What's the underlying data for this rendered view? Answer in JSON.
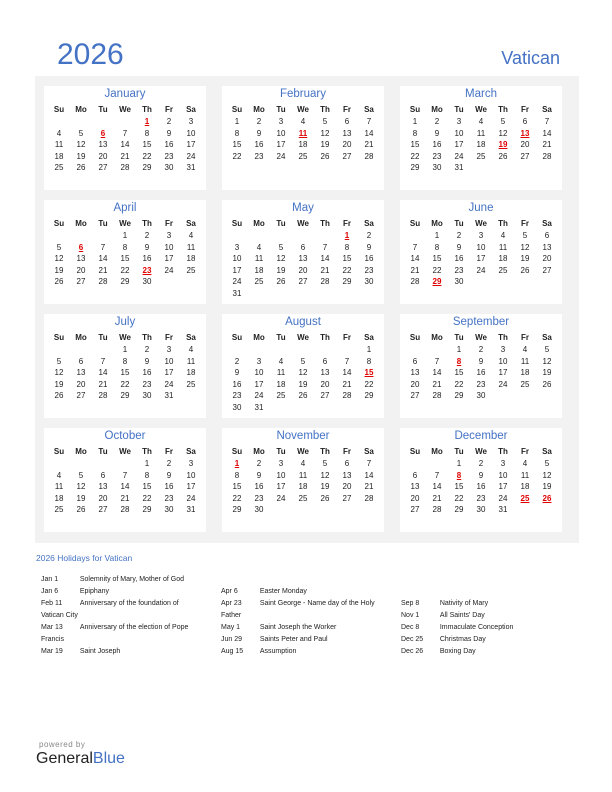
{
  "header": {
    "year": "2026",
    "country": "Vatican"
  },
  "weekdays": [
    "Su",
    "Mo",
    "Tu",
    "We",
    "Th",
    "Fr",
    "Sa"
  ],
  "months": [
    {
      "name": "January",
      "start": 4,
      "days": 31,
      "holidays": [
        1,
        6
      ]
    },
    {
      "name": "February",
      "start": 0,
      "days": 28,
      "holidays": [
        11
      ]
    },
    {
      "name": "March",
      "start": 0,
      "days": 31,
      "holidays": [
        13,
        19
      ]
    },
    {
      "name": "April",
      "start": 3,
      "days": 30,
      "holidays": [
        6,
        23
      ]
    },
    {
      "name": "May",
      "start": 5,
      "days": 31,
      "holidays": [
        1
      ]
    },
    {
      "name": "June",
      "start": 1,
      "days": 30,
      "holidays": [
        29
      ]
    },
    {
      "name": "July",
      "start": 3,
      "days": 31,
      "holidays": []
    },
    {
      "name": "August",
      "start": 6,
      "days": 31,
      "holidays": [
        15
      ]
    },
    {
      "name": "September",
      "start": 2,
      "days": 30,
      "holidays": [
        8
      ]
    },
    {
      "name": "October",
      "start": 4,
      "days": 31,
      "holidays": []
    },
    {
      "name": "November",
      "start": 0,
      "days": 30,
      "holidays": [
        1
      ]
    },
    {
      "name": "December",
      "start": 2,
      "days": 31,
      "holidays": [
        8,
        25,
        26
      ]
    }
  ],
  "holidays_title": "2026 Holidays for Vatican",
  "holidays_columns": [
    [
      {
        "date": "Jan 1",
        "name": "Solemnity of Mary, Mother of God"
      },
      {
        "date": "Jan 6",
        "name": "Epiphany"
      },
      {
        "date": "Feb 11",
        "name": "Anniversary of the foundation of Vatican City"
      },
      {
        "date": "Mar 13",
        "name": "Anniversary of the election of Pope Francis"
      },
      {
        "date": "Mar 19",
        "name": "Saint Joseph"
      }
    ],
    [
      {
        "date": "Apr 6",
        "name": "Easter Monday"
      },
      {
        "date": "Apr 23",
        "name": "Saint George - Name day of the Holy Father"
      },
      {
        "date": "May 1",
        "name": "Saint Joseph the Worker"
      },
      {
        "date": "Jun 29",
        "name": "Saints Peter and Paul"
      },
      {
        "date": "Aug 15",
        "name": "Assumption"
      }
    ],
    [
      {
        "date": "Sep 8",
        "name": "Nativity of Mary"
      },
      {
        "date": "Nov 1",
        "name": "All Saints' Day"
      },
      {
        "date": "Dec 8",
        "name": "Immaculate Conception"
      },
      {
        "date": "Dec 25",
        "name": "Christmas Day"
      },
      {
        "date": "Dec 26",
        "name": "Boxing Day"
      }
    ]
  ],
  "footer": {
    "powered_by": "powered by",
    "brand_general": "General",
    "brand_blue": "Blue"
  }
}
